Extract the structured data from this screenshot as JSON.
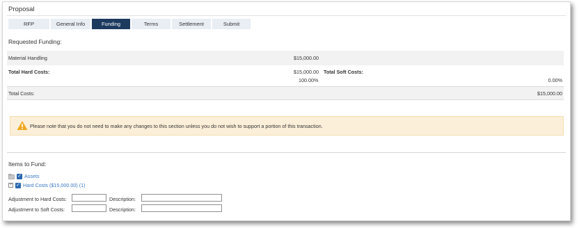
{
  "page": {
    "title": "Proposal",
    "tabs": [
      {
        "label": "RFP",
        "active": false
      },
      {
        "label": "General Info",
        "active": false
      },
      {
        "label": "Funding",
        "active": true
      },
      {
        "label": "Terms",
        "active": false
      },
      {
        "label": "Settlement",
        "active": false
      },
      {
        "label": "Submit",
        "active": false
      }
    ]
  },
  "requested": {
    "heading": "Requested Funding:",
    "material_handling": {
      "label": "Material Handling",
      "amount": "$15,000.00"
    },
    "hard": {
      "label": "Total Hard Costs:",
      "amount": "$15,000.00",
      "percent": "100.00%"
    },
    "soft": {
      "label": "Total Soft Costs:",
      "percent": "0.00%"
    },
    "total": {
      "label": "Total Costs:",
      "amount": "$15,000.00"
    }
  },
  "notice": {
    "text": "Please note that you do not need to make any changes to this section unless you do not wish to support a portion of this transaction.",
    "icon": "warning-icon"
  },
  "items": {
    "heading": "Items to Fund:",
    "assets_label": "Assets",
    "hard_costs_label": "Hard Costs ($15,000.00) (1)",
    "adj_hard_label": "Adjustment to Hard Costs:",
    "adj_soft_label": "Adjustment to Soft Costs:",
    "description_label": "Description:",
    "adj_hard_value": "",
    "adj_soft_value": "",
    "desc_hard_value": "",
    "desc_soft_value": ""
  },
  "colors": {
    "tab_active": "#1d3a5f",
    "tab_inactive": "#e9eef4",
    "notice_bg": "#fcefd9",
    "warning": "#f0a820",
    "link": "#3a78c2",
    "checkbox": "#2a68b0"
  }
}
